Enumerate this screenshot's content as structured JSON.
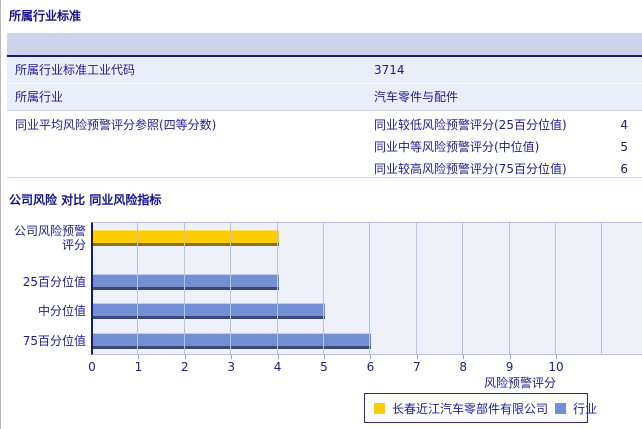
{
  "section1": {
    "title": "所属行业标准",
    "rows": [
      {
        "label": "所属行业标准工业代码",
        "value": "3714"
      },
      {
        "label": "所属行业",
        "value": "汽车零件与配件"
      }
    ],
    "group_row": {
      "label": "同业平均风险预警评分参照(四等分数)",
      "items": [
        {
          "label": "同业较低风险预警评分(25百分位值)",
          "value": "4"
        },
        {
          "label": "同业中等风险预警评分(中位值)",
          "value": "5"
        },
        {
          "label": "同业较高风险预警评分(75百分位值)",
          "value": "6"
        }
      ]
    }
  },
  "section2": {
    "title": "公司风险 对比 同业风险指标"
  },
  "chart_data": {
    "type": "bar",
    "orientation": "horizontal",
    "title": "",
    "categories": [
      "公司风险预警评分",
      "25百分位值",
      "中分位值",
      "75百分位值"
    ],
    "series": [
      {
        "name": "长春近江汽车零部件有限公司",
        "color": "#ffcc00",
        "values": [
          4,
          null,
          null,
          null
        ]
      },
      {
        "name": "行业",
        "color": "#7390d4",
        "values": [
          null,
          4,
          5,
          6
        ]
      }
    ],
    "xlabel": "风险预警评分",
    "xlim": [
      0,
      10
    ],
    "x_ticks": [
      "0",
      "1",
      "2",
      "3",
      "4",
      "5",
      "6",
      "7",
      "8",
      "9",
      "10"
    ],
    "grid": "vertical",
    "legend_position": "bottom-right",
    "colors": {
      "plot_bg": "#eef1f8",
      "gridline": "#b7c3e2",
      "axis": "#1a1a6e"
    }
  }
}
